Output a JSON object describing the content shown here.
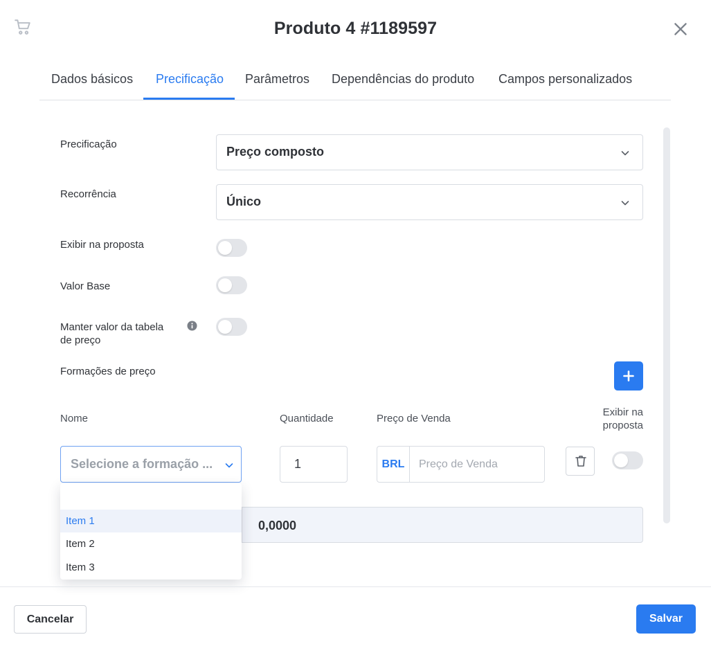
{
  "header": {
    "title": "Produto 4 #1189597",
    "cart_icon": "cart-icon",
    "close_icon": "close-icon"
  },
  "tabs": [
    {
      "label": "Dados básicos",
      "active": false
    },
    {
      "label": "Precificação",
      "active": true
    },
    {
      "label": "Parâmetros",
      "active": false
    },
    {
      "label": "Dependências do produto",
      "active": false
    },
    {
      "label": "Campos personalizados",
      "active": false
    }
  ],
  "form": {
    "pricing": {
      "label": "Precificação",
      "value": "Preço composto"
    },
    "recurrence": {
      "label": "Recorrência",
      "value": "Único"
    },
    "show_in_proposal": {
      "label": "Exibir na proposta",
      "on": false
    },
    "base_value": {
      "label": "Valor Base",
      "on": false
    },
    "keep_table_value": {
      "label": "Manter valor da tabela de preço",
      "on": false
    },
    "price_formations_label": "Formações de preço"
  },
  "formation_table": {
    "headers": {
      "name": "Nome",
      "quantity": "Quantidade",
      "sale_price": "Preço de Venda",
      "show_in_proposal": "Exibir na proposta"
    },
    "row": {
      "name_placeholder": "Selecione a formação ...",
      "quantity": "1",
      "currency": "BRL",
      "price_placeholder": "Preço de Venda",
      "show_in_proposal": false
    },
    "total": "0,0000"
  },
  "dropdown": {
    "options": [
      "Item 1",
      "Item 2",
      "Item 3"
    ],
    "highlighted": "Item 1"
  },
  "footer": {
    "cancel_label": "Cancelar",
    "save_label": "Salvar"
  },
  "colors": {
    "accent": "#2a7bf0",
    "text": "#2f3237",
    "border": "#d8dce2"
  }
}
